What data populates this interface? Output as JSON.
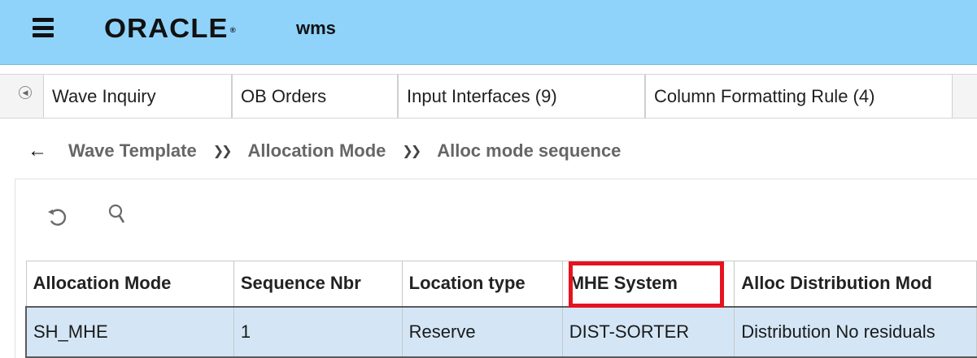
{
  "header": {
    "brand": "ORACLE",
    "brand_mark": "®",
    "app_name": "wms",
    "colors": {
      "header_bg": "#8fd3fb",
      "row_selected_bg": "#d4e6f6",
      "highlight": "#e5131f"
    }
  },
  "tabs": [
    {
      "label": "Wave Inquiry"
    },
    {
      "label": "OB Orders"
    },
    {
      "label": "Input Interfaces (9)"
    },
    {
      "label": "Column Formatting Rule (4)"
    }
  ],
  "breadcrumb": {
    "back_icon": "←",
    "separator": "»",
    "items": [
      {
        "label": "Wave Template"
      },
      {
        "label": "Allocation Mode"
      },
      {
        "label": "Alloc mode sequence"
      }
    ]
  },
  "toolbar": {
    "refresh_icon": "refresh-icon",
    "search_icon": "search-icon"
  },
  "table": {
    "columns": [
      "Allocation Mode",
      "Sequence Nbr",
      "Location type",
      "MHE System",
      "Alloc Distribution Mod"
    ],
    "rows": [
      [
        "SH_MHE",
        "1",
        "Reserve",
        "DIST-SORTER",
        "Distribution No residuals"
      ]
    ],
    "highlighted_column": "MHE System"
  }
}
